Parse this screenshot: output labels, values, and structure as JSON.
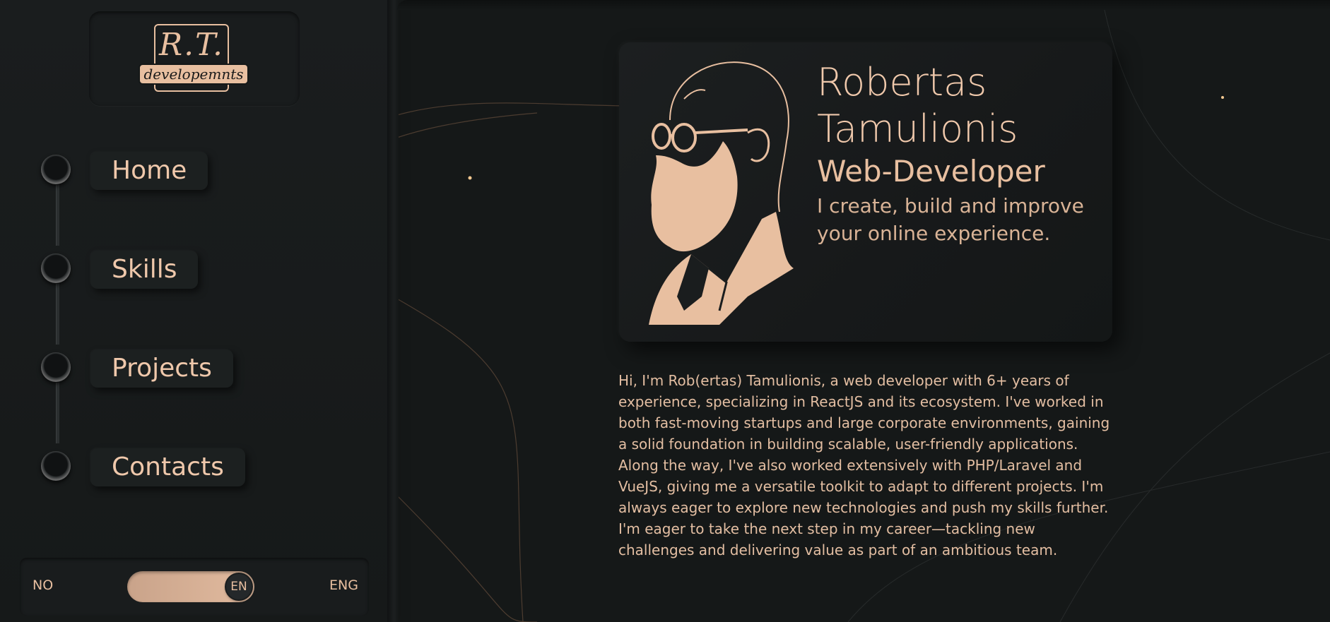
{
  "logo": {
    "initials": "R.T.",
    "tagline": "developemnts"
  },
  "nav": {
    "items": [
      {
        "label": "Home"
      },
      {
        "label": "Skills"
      },
      {
        "label": "Projects"
      },
      {
        "label": "Contacts"
      }
    ]
  },
  "language": {
    "left_label": "NO",
    "right_label": "ENG",
    "selected": "EN"
  },
  "hero": {
    "first_name": "Robertas",
    "last_name": "Tamulionis",
    "role": "Web-Developer",
    "tagline": "I create, build and improve your online experience."
  },
  "about": {
    "paragraphs": [
      "Hi, I'm Rob(ertas) Tamulionis, a web developer with 6+ years of experience, specializing in ReactJS and its ecosystem. I've worked in both fast-moving startups and large corporate environments, gaining a solid foundation in building scalable, user-friendly applications.",
      "Along the way, I've also worked extensively with PHP/Laravel and VueJS, giving me a versatile toolkit to adapt to different projects. I'm always eager to explore new technologies and push my skills further.",
      "I'm eager to take the next step in my career—tackling new challenges and delivering value as part of an ambitious team."
    ]
  },
  "colors": {
    "accent": "#e8bfa0",
    "background": "#151818",
    "panel": "#1c2020"
  }
}
